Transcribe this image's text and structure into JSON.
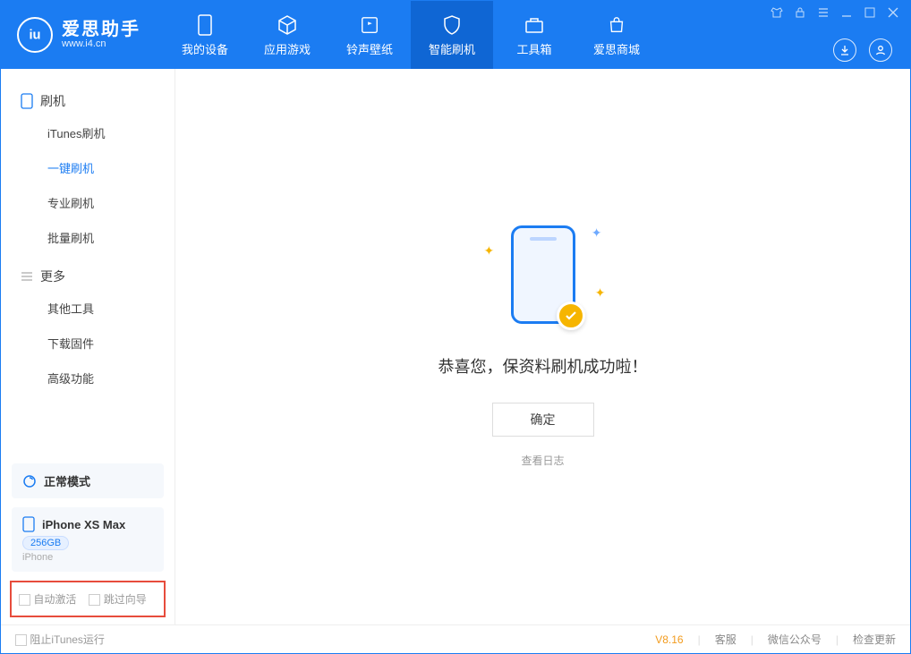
{
  "app": {
    "name": "爱思助手",
    "url": "www.i4.cn"
  },
  "nav": [
    {
      "label": "我的设备"
    },
    {
      "label": "应用游戏"
    },
    {
      "label": "铃声壁纸"
    },
    {
      "label": "智能刷机",
      "active": true
    },
    {
      "label": "工具箱"
    },
    {
      "label": "爱思商城"
    }
  ],
  "sidebar": {
    "group1": {
      "title": "刷机",
      "items": [
        {
          "label": "iTunes刷机"
        },
        {
          "label": "一键刷机",
          "active": true
        },
        {
          "label": "专业刷机"
        },
        {
          "label": "批量刷机"
        }
      ]
    },
    "group2": {
      "title": "更多",
      "items": [
        {
          "label": "其他工具"
        },
        {
          "label": "下载固件"
        },
        {
          "label": "高级功能"
        }
      ]
    },
    "mode_card": {
      "label": "正常模式"
    },
    "device_card": {
      "name": "iPhone XS Max",
      "storage": "256GB",
      "type": "iPhone"
    },
    "checkbox1": "自动激活",
    "checkbox2": "跳过向导"
  },
  "main": {
    "message": "恭喜您，保资料刷机成功啦！",
    "ok_button": "确定",
    "view_log": "查看日志"
  },
  "footer": {
    "block_itunes": "阻止iTunes运行",
    "version": "V8.16",
    "links": [
      "客服",
      "微信公众号",
      "检查更新"
    ]
  }
}
